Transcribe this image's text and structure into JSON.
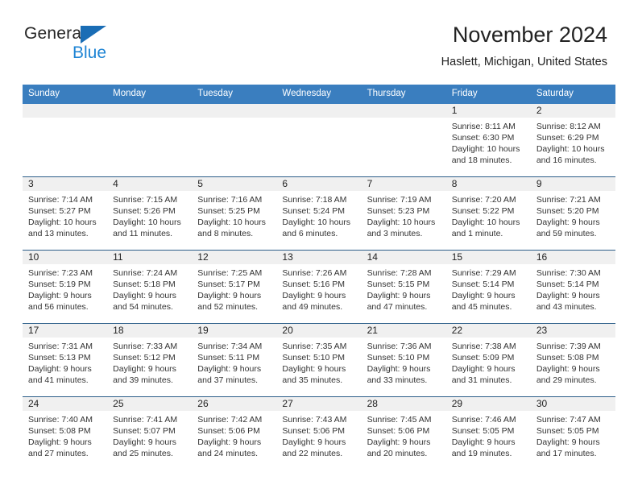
{
  "brand": {
    "name_part1": "General",
    "name_part2": "Blue",
    "logo_icon": "triangle-logo-icon"
  },
  "header": {
    "title": "November 2024",
    "location": "Haslett, Michigan, United States"
  },
  "colors": {
    "header_blue": "#3a7ebf",
    "row_divider": "#2d5f8a",
    "daynum_band": "#f0f0f0",
    "brand_blue": "#1e84d4",
    "logo_blue": "#1a6db5",
    "text": "#222222"
  },
  "weekday_headers": [
    "Sunday",
    "Monday",
    "Tuesday",
    "Wednesday",
    "Thursday",
    "Friday",
    "Saturday"
  ],
  "labels": {
    "sunrise": "Sunrise:",
    "sunset": "Sunset:",
    "daylight": "Daylight:"
  },
  "weeks": [
    [
      {
        "day": "",
        "blank": true,
        "sunrise": "",
        "sunset": "",
        "daylight_l1": "",
        "daylight_l2": ""
      },
      {
        "day": "",
        "blank": true,
        "sunrise": "",
        "sunset": "",
        "daylight_l1": "",
        "daylight_l2": ""
      },
      {
        "day": "",
        "blank": true,
        "sunrise": "",
        "sunset": "",
        "daylight_l1": "",
        "daylight_l2": ""
      },
      {
        "day": "",
        "blank": true,
        "sunrise": "",
        "sunset": "",
        "daylight_l1": "",
        "daylight_l2": ""
      },
      {
        "day": "",
        "blank": true,
        "sunrise": "",
        "sunset": "",
        "daylight_l1": "",
        "daylight_l2": ""
      },
      {
        "day": "1",
        "blank": false,
        "sunrise": "Sunrise: 8:11 AM",
        "sunset": "Sunset: 6:30 PM",
        "daylight_l1": "Daylight: 10 hours",
        "daylight_l2": "and 18 minutes."
      },
      {
        "day": "2",
        "blank": false,
        "sunrise": "Sunrise: 8:12 AM",
        "sunset": "Sunset: 6:29 PM",
        "daylight_l1": "Daylight: 10 hours",
        "daylight_l2": "and 16 minutes."
      }
    ],
    [
      {
        "day": "3",
        "blank": false,
        "sunrise": "Sunrise: 7:14 AM",
        "sunset": "Sunset: 5:27 PM",
        "daylight_l1": "Daylight: 10 hours",
        "daylight_l2": "and 13 minutes."
      },
      {
        "day": "4",
        "blank": false,
        "sunrise": "Sunrise: 7:15 AM",
        "sunset": "Sunset: 5:26 PM",
        "daylight_l1": "Daylight: 10 hours",
        "daylight_l2": "and 11 minutes."
      },
      {
        "day": "5",
        "blank": false,
        "sunrise": "Sunrise: 7:16 AM",
        "sunset": "Sunset: 5:25 PM",
        "daylight_l1": "Daylight: 10 hours",
        "daylight_l2": "and 8 minutes."
      },
      {
        "day": "6",
        "blank": false,
        "sunrise": "Sunrise: 7:18 AM",
        "sunset": "Sunset: 5:24 PM",
        "daylight_l1": "Daylight: 10 hours",
        "daylight_l2": "and 6 minutes."
      },
      {
        "day": "7",
        "blank": false,
        "sunrise": "Sunrise: 7:19 AM",
        "sunset": "Sunset: 5:23 PM",
        "daylight_l1": "Daylight: 10 hours",
        "daylight_l2": "and 3 minutes."
      },
      {
        "day": "8",
        "blank": false,
        "sunrise": "Sunrise: 7:20 AM",
        "sunset": "Sunset: 5:22 PM",
        "daylight_l1": "Daylight: 10 hours",
        "daylight_l2": "and 1 minute."
      },
      {
        "day": "9",
        "blank": false,
        "sunrise": "Sunrise: 7:21 AM",
        "sunset": "Sunset: 5:20 PM",
        "daylight_l1": "Daylight: 9 hours",
        "daylight_l2": "and 59 minutes."
      }
    ],
    [
      {
        "day": "10",
        "blank": false,
        "sunrise": "Sunrise: 7:23 AM",
        "sunset": "Sunset: 5:19 PM",
        "daylight_l1": "Daylight: 9 hours",
        "daylight_l2": "and 56 minutes."
      },
      {
        "day": "11",
        "blank": false,
        "sunrise": "Sunrise: 7:24 AM",
        "sunset": "Sunset: 5:18 PM",
        "daylight_l1": "Daylight: 9 hours",
        "daylight_l2": "and 54 minutes."
      },
      {
        "day": "12",
        "blank": false,
        "sunrise": "Sunrise: 7:25 AM",
        "sunset": "Sunset: 5:17 PM",
        "daylight_l1": "Daylight: 9 hours",
        "daylight_l2": "and 52 minutes."
      },
      {
        "day": "13",
        "blank": false,
        "sunrise": "Sunrise: 7:26 AM",
        "sunset": "Sunset: 5:16 PM",
        "daylight_l1": "Daylight: 9 hours",
        "daylight_l2": "and 49 minutes."
      },
      {
        "day": "14",
        "blank": false,
        "sunrise": "Sunrise: 7:28 AM",
        "sunset": "Sunset: 5:15 PM",
        "daylight_l1": "Daylight: 9 hours",
        "daylight_l2": "and 47 minutes."
      },
      {
        "day": "15",
        "blank": false,
        "sunrise": "Sunrise: 7:29 AM",
        "sunset": "Sunset: 5:14 PM",
        "daylight_l1": "Daylight: 9 hours",
        "daylight_l2": "and 45 minutes."
      },
      {
        "day": "16",
        "blank": false,
        "sunrise": "Sunrise: 7:30 AM",
        "sunset": "Sunset: 5:14 PM",
        "daylight_l1": "Daylight: 9 hours",
        "daylight_l2": "and 43 minutes."
      }
    ],
    [
      {
        "day": "17",
        "blank": false,
        "sunrise": "Sunrise: 7:31 AM",
        "sunset": "Sunset: 5:13 PM",
        "daylight_l1": "Daylight: 9 hours",
        "daylight_l2": "and 41 minutes."
      },
      {
        "day": "18",
        "blank": false,
        "sunrise": "Sunrise: 7:33 AM",
        "sunset": "Sunset: 5:12 PM",
        "daylight_l1": "Daylight: 9 hours",
        "daylight_l2": "and 39 minutes."
      },
      {
        "day": "19",
        "blank": false,
        "sunrise": "Sunrise: 7:34 AM",
        "sunset": "Sunset: 5:11 PM",
        "daylight_l1": "Daylight: 9 hours",
        "daylight_l2": "and 37 minutes."
      },
      {
        "day": "20",
        "blank": false,
        "sunrise": "Sunrise: 7:35 AM",
        "sunset": "Sunset: 5:10 PM",
        "daylight_l1": "Daylight: 9 hours",
        "daylight_l2": "and 35 minutes."
      },
      {
        "day": "21",
        "blank": false,
        "sunrise": "Sunrise: 7:36 AM",
        "sunset": "Sunset: 5:10 PM",
        "daylight_l1": "Daylight: 9 hours",
        "daylight_l2": "and 33 minutes."
      },
      {
        "day": "22",
        "blank": false,
        "sunrise": "Sunrise: 7:38 AM",
        "sunset": "Sunset: 5:09 PM",
        "daylight_l1": "Daylight: 9 hours",
        "daylight_l2": "and 31 minutes."
      },
      {
        "day": "23",
        "blank": false,
        "sunrise": "Sunrise: 7:39 AM",
        "sunset": "Sunset: 5:08 PM",
        "daylight_l1": "Daylight: 9 hours",
        "daylight_l2": "and 29 minutes."
      }
    ],
    [
      {
        "day": "24",
        "blank": false,
        "sunrise": "Sunrise: 7:40 AM",
        "sunset": "Sunset: 5:08 PM",
        "daylight_l1": "Daylight: 9 hours",
        "daylight_l2": "and 27 minutes."
      },
      {
        "day": "25",
        "blank": false,
        "sunrise": "Sunrise: 7:41 AM",
        "sunset": "Sunset: 5:07 PM",
        "daylight_l1": "Daylight: 9 hours",
        "daylight_l2": "and 25 minutes."
      },
      {
        "day": "26",
        "blank": false,
        "sunrise": "Sunrise: 7:42 AM",
        "sunset": "Sunset: 5:06 PM",
        "daylight_l1": "Daylight: 9 hours",
        "daylight_l2": "and 24 minutes."
      },
      {
        "day": "27",
        "blank": false,
        "sunrise": "Sunrise: 7:43 AM",
        "sunset": "Sunset: 5:06 PM",
        "daylight_l1": "Daylight: 9 hours",
        "daylight_l2": "and 22 minutes."
      },
      {
        "day": "28",
        "blank": false,
        "sunrise": "Sunrise: 7:45 AM",
        "sunset": "Sunset: 5:06 PM",
        "daylight_l1": "Daylight: 9 hours",
        "daylight_l2": "and 20 minutes."
      },
      {
        "day": "29",
        "blank": false,
        "sunrise": "Sunrise: 7:46 AM",
        "sunset": "Sunset: 5:05 PM",
        "daylight_l1": "Daylight: 9 hours",
        "daylight_l2": "and 19 minutes."
      },
      {
        "day": "30",
        "blank": false,
        "sunrise": "Sunrise: 7:47 AM",
        "sunset": "Sunset: 5:05 PM",
        "daylight_l1": "Daylight: 9 hours",
        "daylight_l2": "and 17 minutes."
      }
    ]
  ]
}
